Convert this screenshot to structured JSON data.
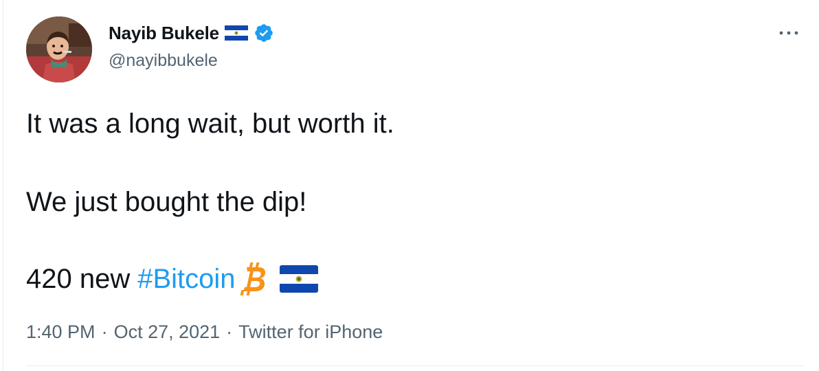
{
  "author": {
    "display_name": "Nayib Bukele",
    "handle": "@nayibbukele",
    "verified": true
  },
  "tweet": {
    "line1": "It was a long wait, but worth it.",
    "line2": "We just bought the dip!",
    "line3_prefix": "420 new",
    "hashtag": "#Bitcoin",
    "emoji": [
      "bitcoin-icon",
      "el-salvador-flag-icon"
    ]
  },
  "meta": {
    "time": "1:40 PM",
    "date": "Oct 27, 2021",
    "source": "Twitter for iPhone",
    "separator": "·"
  },
  "colors": {
    "link": "#1d9bf0",
    "text": "#0f1419",
    "secondary": "#536471",
    "bitcoin": "#f7931a",
    "flag_blue": "#0f47af"
  }
}
